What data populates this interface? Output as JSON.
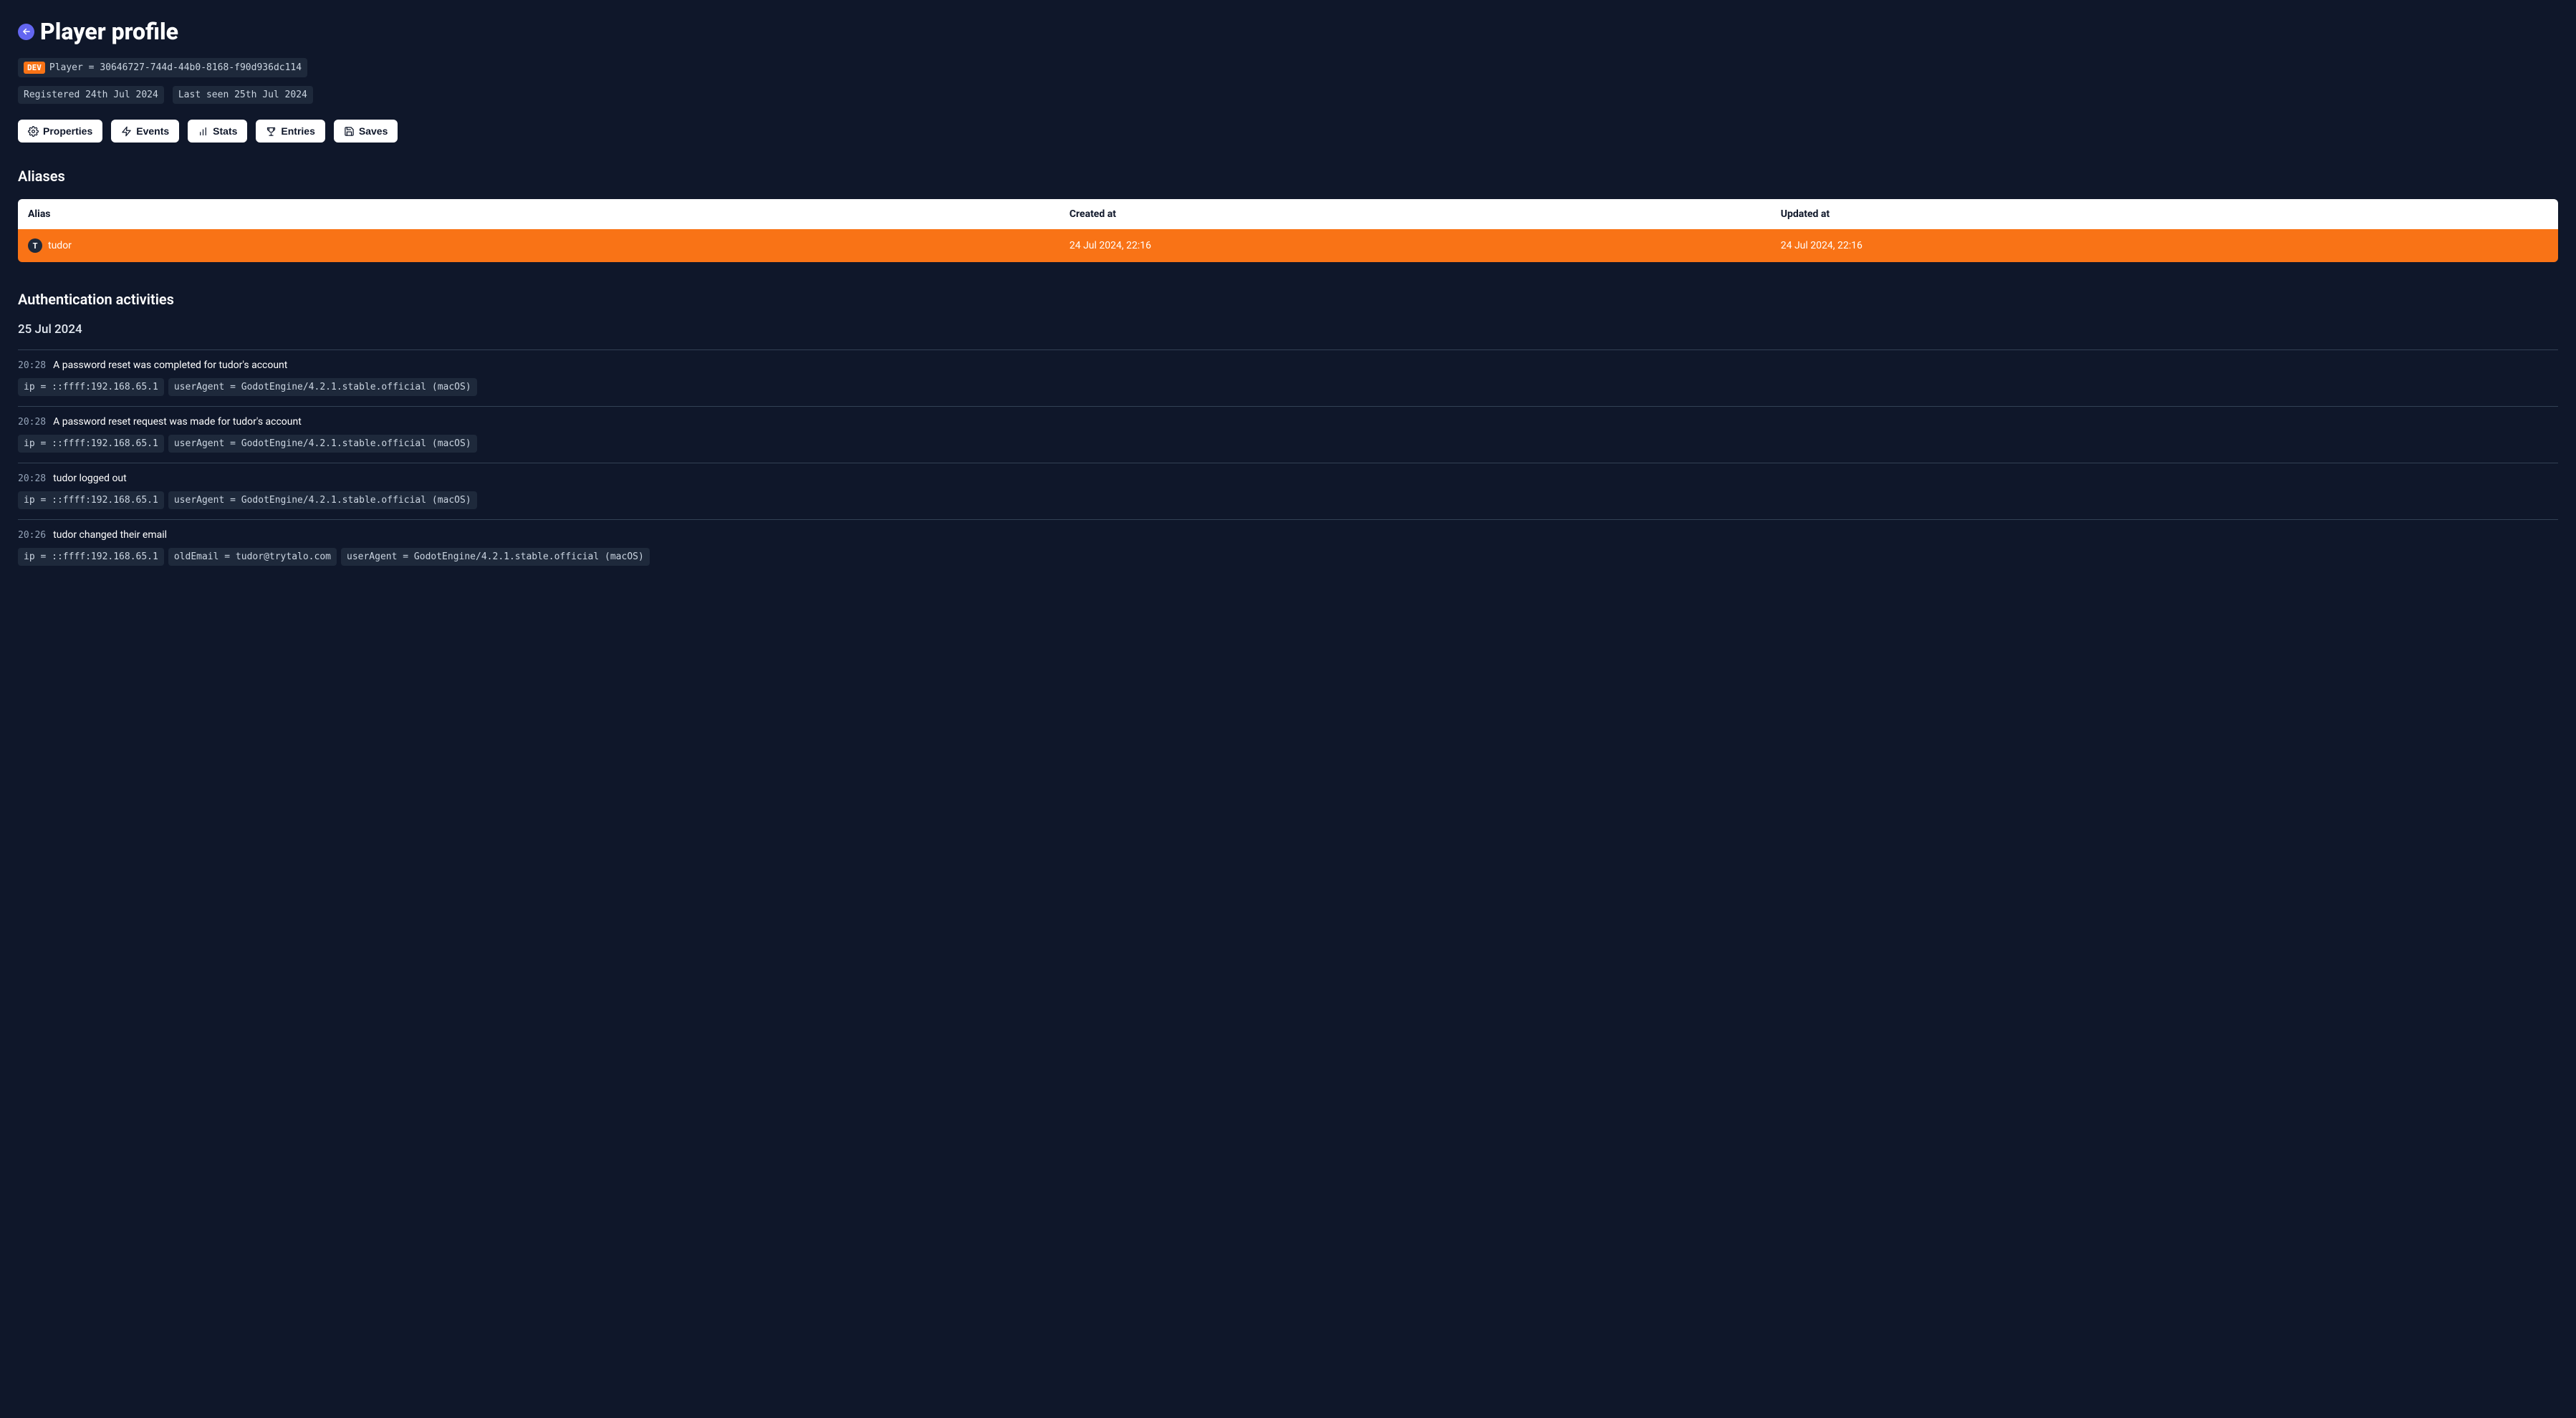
{
  "header": {
    "title": "Player profile"
  },
  "identity": {
    "dev_badge": "DEV",
    "player_line": "Player = 30646727-744d-44b0-8168-f90d936dc114",
    "registered": "Registered 24th Jul 2024",
    "last_seen": "Last seen 25th Jul 2024"
  },
  "tabs": {
    "properties": "Properties",
    "events": "Events",
    "stats": "Stats",
    "entries": "Entries",
    "saves": "Saves"
  },
  "aliases_section": {
    "title": "Aliases",
    "columns": {
      "alias": "Alias",
      "created": "Created at",
      "updated": "Updated at"
    },
    "rows": [
      {
        "icon": "T",
        "alias": "tudor",
        "created": "24 Jul 2024, 22:16",
        "updated": "24 Jul 2024, 22:16"
      }
    ]
  },
  "auth_section": {
    "title": "Authentication activities",
    "date": "25 Jul 2024",
    "activities": [
      {
        "time": "20:28",
        "message": "A password reset was completed for tudor's account",
        "meta": [
          "ip = ::ffff:192.168.65.1",
          "userAgent = GodotEngine/4.2.1.stable.official (macOS)"
        ]
      },
      {
        "time": "20:28",
        "message": "A password reset request was made for tudor's account",
        "meta": [
          "ip = ::ffff:192.168.65.1",
          "userAgent = GodotEngine/4.2.1.stable.official (macOS)"
        ]
      },
      {
        "time": "20:28",
        "message": "tudor logged out",
        "meta": [
          "ip = ::ffff:192.168.65.1",
          "userAgent = GodotEngine/4.2.1.stable.official (macOS)"
        ]
      },
      {
        "time": "20:26",
        "message": "tudor changed their email",
        "meta": [
          "ip = ::ffff:192.168.65.1",
          "oldEmail = tudor@trytalo.com",
          "userAgent = GodotEngine/4.2.1.stable.official (macOS)"
        ]
      }
    ]
  }
}
